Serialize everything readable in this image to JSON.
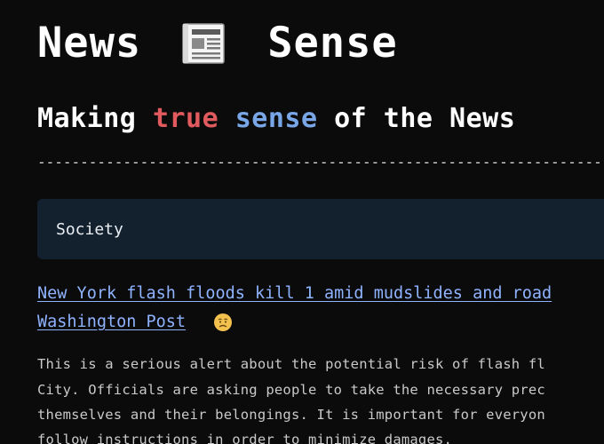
{
  "header": {
    "title_left": "News",
    "title_icon": "newspaper-icon",
    "title_right": "Sense"
  },
  "tagline": {
    "making": "Making",
    "true_word": "true",
    "sense_word": "sense",
    "rest": "of the News"
  },
  "divider": "------------------------------------------------------------------------",
  "category": {
    "label": "Society"
  },
  "article": {
    "headline_line1": "New York flash floods kill 1 amid mudslides and road",
    "source_line": "Washington Post",
    "sentiment_icon": "worried-face-emoji",
    "summary_lines": [
      "This is a serious alert about the potential risk of flash fl",
      "City. Officials are asking people to take the necessary prec",
      "themselves and their belongings. It is important for everyon",
      "follow instructions in order to minimize damages."
    ]
  },
  "colors": {
    "background": "#0b0b0c",
    "true_word": "#e05a5e",
    "sense_word": "#79a6e6",
    "category_bar": "#13212f",
    "link": "#8fb3ff"
  }
}
